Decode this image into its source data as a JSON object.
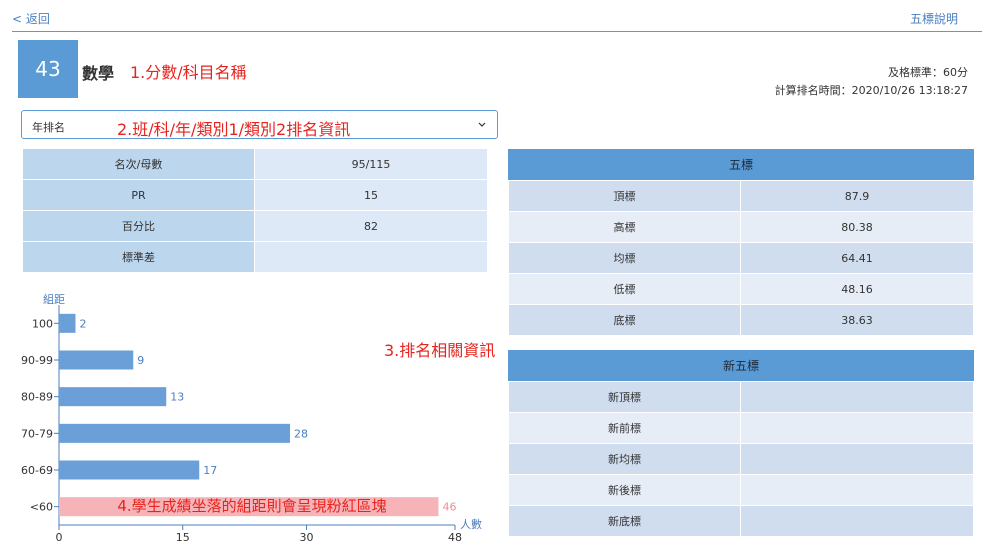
{
  "nav": {
    "back_label": "< 返回",
    "help_label": "五標說明"
  },
  "header": {
    "score": "43",
    "subject": "數學",
    "pass_line": "及格標準：60分",
    "calc_time": "計算排名時間：2020/10/26 13:18:27"
  },
  "annotations": {
    "a1": "1.分數/科目名稱",
    "a2": "2.班/科/年/類別1/類別2排名資訊",
    "a3": "3.排名相關資訊",
    "a4": "4.學生成績坐落的組距則會呈現粉紅區塊"
  },
  "rank_select": {
    "value": "年排名"
  },
  "rank_table": [
    {
      "label": "名次/母數",
      "value": "95/115"
    },
    {
      "label": "PR",
      "value": "15"
    },
    {
      "label": "百分比",
      "value": "82"
    },
    {
      "label": "標準差",
      "value": ""
    }
  ],
  "five_standards": {
    "title": "五標",
    "rows": [
      {
        "label": "頂標",
        "value": "87.9"
      },
      {
        "label": "高標",
        "value": "80.38"
      },
      {
        "label": "均標",
        "value": "64.41"
      },
      {
        "label": "低標",
        "value": "48.16"
      },
      {
        "label": "底標",
        "value": "38.63"
      }
    ]
  },
  "new_five_standards": {
    "title": "新五標",
    "rows": [
      {
        "label": "新頂標",
        "value": ""
      },
      {
        "label": "新前標",
        "value": ""
      },
      {
        "label": "新均標",
        "value": ""
      },
      {
        "label": "新後標",
        "value": ""
      },
      {
        "label": "新底標",
        "value": ""
      }
    ]
  },
  "chart_data": {
    "type": "bar",
    "orientation": "horizontal",
    "ylabel": "組距",
    "xlabel": "人數",
    "categories": [
      "100",
      "90-99",
      "80-89",
      "70-79",
      "60-69",
      "<60"
    ],
    "values": [
      2,
      9,
      13,
      28,
      17,
      46
    ],
    "xlim": [
      0,
      48
    ],
    "xticks": [
      0,
      15,
      30,
      48
    ],
    "highlight_category": "<60",
    "colors": {
      "bar": "#6a9fd8",
      "highlight": "#f7b4b8",
      "label": "#4a7fc0",
      "highlight_label": "#f08a93"
    }
  }
}
